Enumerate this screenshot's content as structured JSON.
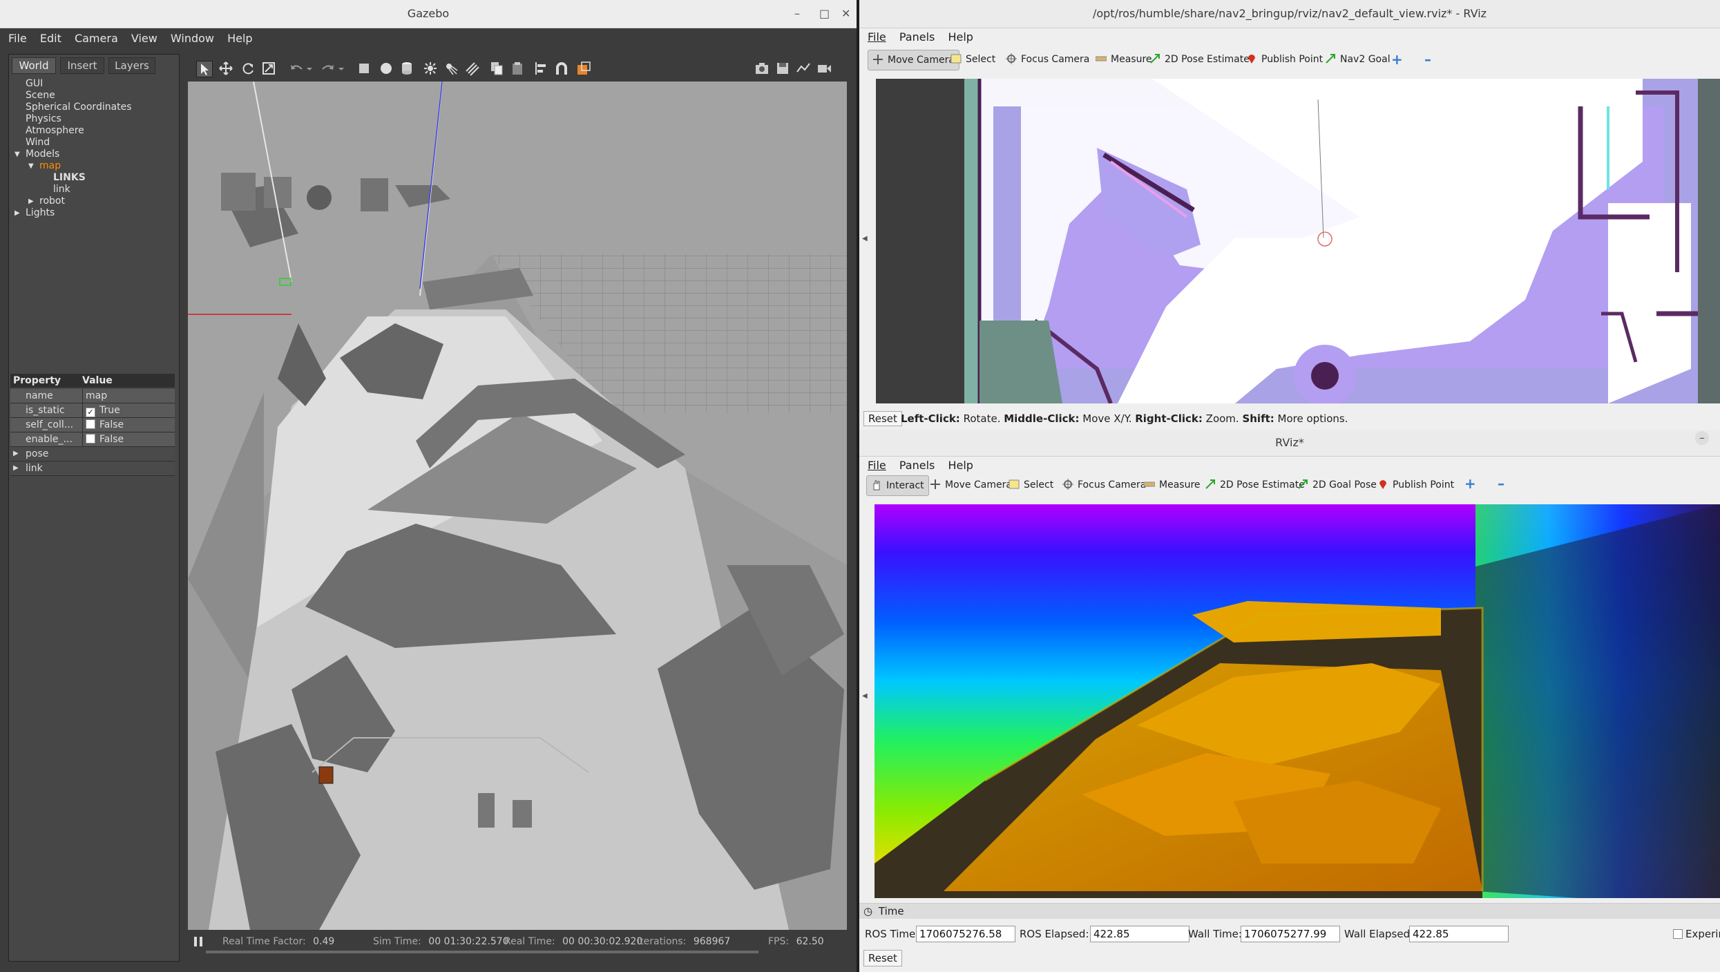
{
  "gazebo": {
    "title": "Gazebo",
    "menu": [
      "File",
      "Edit",
      "Camera",
      "View",
      "Window",
      "Help"
    ],
    "tabs": [
      "World",
      "Insert",
      "Layers"
    ],
    "tree": [
      {
        "label": "GUI",
        "indent": 0,
        "arrow": ""
      },
      {
        "label": "Scene",
        "indent": 0,
        "arrow": ""
      },
      {
        "label": "Spherical Coordinates",
        "indent": 0,
        "arrow": ""
      },
      {
        "label": "Physics",
        "indent": 0,
        "arrow": ""
      },
      {
        "label": "Atmosphere",
        "indent": 0,
        "arrow": ""
      },
      {
        "label": "Wind",
        "indent": 0,
        "arrow": ""
      },
      {
        "label": "Models",
        "indent": 0,
        "arrow": "open"
      },
      {
        "label": "map",
        "indent": 1,
        "arrow": "open",
        "selected": true
      },
      {
        "label": "LINKS",
        "indent": 2,
        "arrow": "",
        "bold": true
      },
      {
        "label": "link",
        "indent": 2,
        "arrow": ""
      },
      {
        "label": "robot",
        "indent": 1,
        "arrow": "closed"
      },
      {
        "label": "Lights",
        "indent": 0,
        "arrow": "closed"
      }
    ],
    "props_header": {
      "property": "Property",
      "value": "Value"
    },
    "props": [
      {
        "name": "name",
        "value": "map",
        "check": null
      },
      {
        "name": "is_static",
        "value": "True",
        "check": true
      },
      {
        "name": "self_coll...",
        "value": "False",
        "check": false
      },
      {
        "name": "enable_...",
        "value": "False",
        "check": false
      },
      {
        "name": "pose",
        "value": "",
        "check": null,
        "arrow": true
      },
      {
        "name": "link",
        "value": "",
        "check": null,
        "arrow": true
      }
    ],
    "status": {
      "rtf_label": "Real Time Factor:",
      "rtf": "0.49",
      "sim_label": "Sim Time:",
      "sim": "00 01:30:22.570",
      "real_label": "Real Time:",
      "real": "00 00:30:02.920",
      "iter_label": "Iterations:",
      "iter": "968967",
      "fps_label": "FPS:",
      "fps": "62.50"
    }
  },
  "rviz_top": {
    "title": "/opt/ros/humble/share/nav2_bringup/rviz/nav2_default_view.rviz* - RViz",
    "menu": [
      "File",
      "Panels",
      "Help"
    ],
    "tools": [
      "Move Camera",
      "Select",
      "Focus Camera",
      "Measure",
      "2D Pose Estimate",
      "Publish Point",
      "Nav2 Goal"
    ],
    "reset": "Reset",
    "hint": {
      "a": "Left-Click:",
      "b": " Rotate. ",
      "c": "Middle-Click:",
      "d": " Move X/Y. ",
      "e": "Right-Click:",
      "f": " Zoom. ",
      "g": "Shift:",
      "h": " More options."
    }
  },
  "rviz_bottom": {
    "title": "RViz*",
    "menu": [
      "File",
      "Panels",
      "Help"
    ],
    "tools": [
      "Interact",
      "Move Camera",
      "Select",
      "Focus Camera",
      "Measure",
      "2D Pose Estimate",
      "2D Goal Pose",
      "Publish Point"
    ],
    "time_panel": "Time",
    "ros_time_label": "ROS Time:",
    "ros_time": "1706075276.58",
    "ros_elapsed_label": "ROS Elapsed:",
    "ros_elapsed": "422.85",
    "wall_time_label": "Wall Time:",
    "wall_time": "1706075277.99",
    "wall_elapsed_label": "Wall Elapsed:",
    "wall_elapsed": "422.85",
    "experimental": "Experin",
    "reset": "Reset"
  },
  "colors": {
    "selected": "#ff8c00",
    "accent_blue": "#3a7bd5"
  }
}
